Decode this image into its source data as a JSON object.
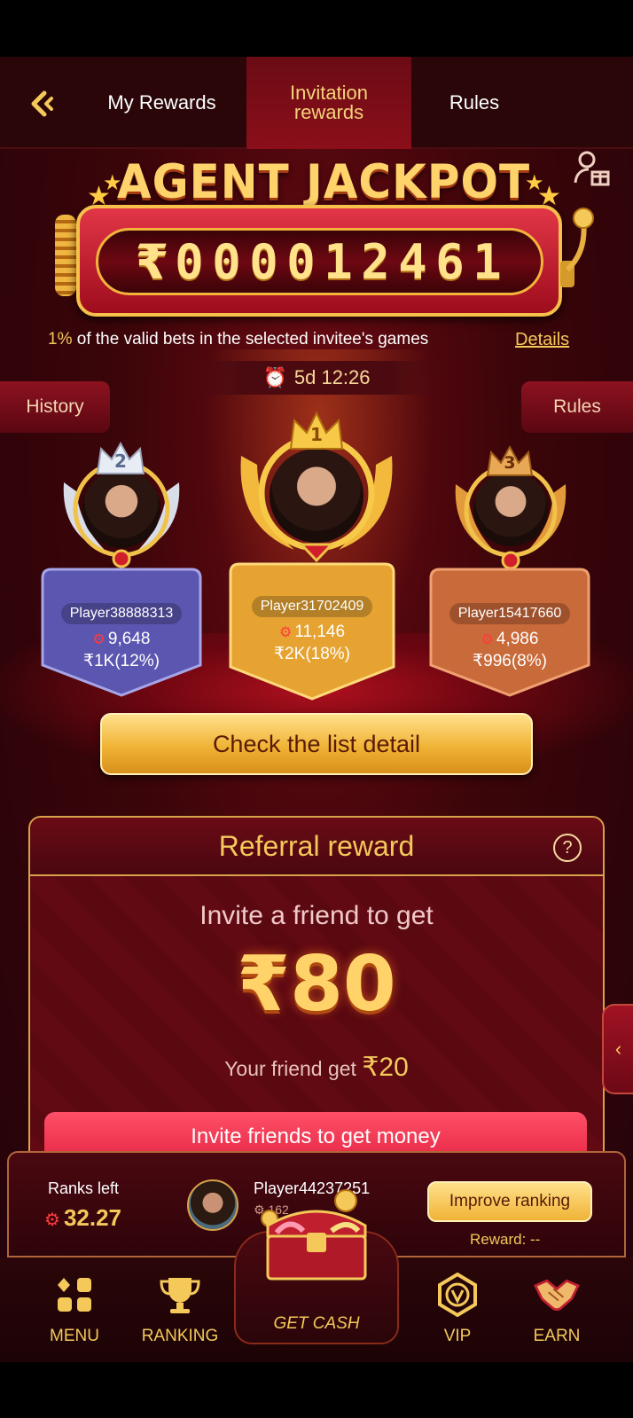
{
  "header": {
    "tabs": [
      {
        "label": "My Rewards"
      },
      {
        "label": "Invitation\nrewards"
      },
      {
        "label": "Rules"
      }
    ]
  },
  "jackpot": {
    "title": "AGENT JACKPOT",
    "digits": [
      "₹",
      "0",
      "0",
      "0",
      "0",
      "1",
      "2",
      "4",
      "6",
      "1"
    ],
    "bets_pct": "1%",
    "bets_text": " of the valid bets in the selected invitee's games",
    "details_label": "Details",
    "timer": "5d 12:26",
    "history_label": "History",
    "rules_label": "Rules"
  },
  "podium": [
    {
      "rank": "1",
      "name": "Player31702409",
      "score": "11,146",
      "reward": "₹2K(18%)"
    },
    {
      "rank": "2",
      "name": "Player38888313",
      "score": "9,648",
      "reward": "₹1K(12%)"
    },
    {
      "rank": "3",
      "name": "Player15417660",
      "score": "4,986",
      "reward": "₹996(8%)"
    }
  ],
  "check_list_label": "Check the list detail",
  "referral": {
    "title": "Referral reward",
    "invite_line": "Invite a friend to get",
    "amount": "₹80",
    "friend_get_text": "Your friend get ",
    "friend_get_amount": "₹20",
    "invite_button": "Invite friends to get money"
  },
  "rank_bar": {
    "ranks_left_label": "Ranks left",
    "ranks_left_value": "32.27",
    "player_name": "Player44237251",
    "player_score": "162",
    "improve_label": "Improve ranking",
    "reward_label": "Reward: --"
  },
  "nav": {
    "menu": "MENU",
    "ranking": "RANKING",
    "get_cash": "GET CASH",
    "vip": "VIP",
    "earn": "EARN"
  },
  "colors": {
    "accent_gold": "#f4c95a",
    "bg_red": "#3b0509",
    "button_red": "#e01d3c"
  }
}
